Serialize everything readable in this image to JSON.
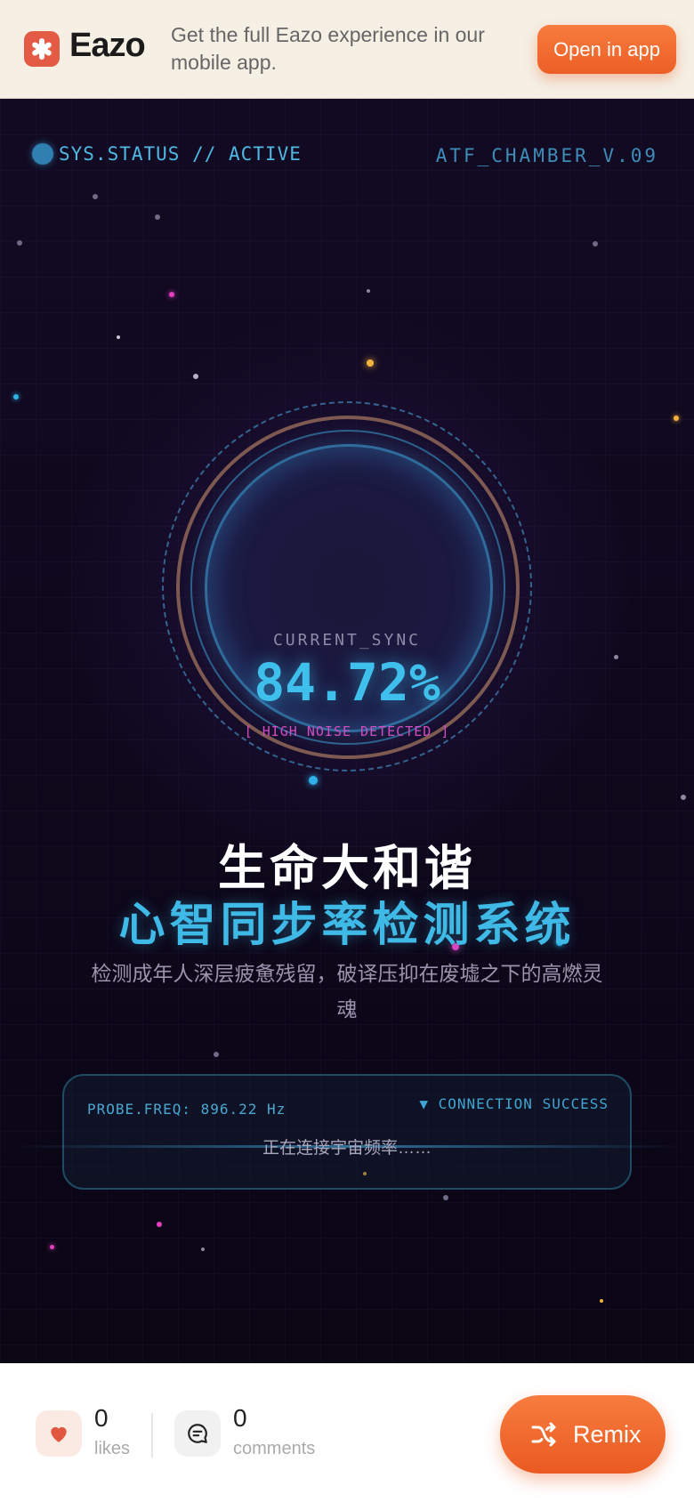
{
  "banner": {
    "logo_text": "Eazo",
    "message": "Get the full Eazo experience in our mobile app.",
    "open_label": "Open in app"
  },
  "hud": {
    "status": "SYS.STATUS // ACTIVE",
    "chamber": "ATF_CHAMBER_V.09"
  },
  "gauge": {
    "label": "CURRENT_SYNC",
    "value": "84.72%",
    "warning": "[ HIGH NOISE DETECTED ]"
  },
  "titles": {
    "line1": "生命大和谐",
    "line2": "心智同步率检测系统",
    "subtitle": "检测成年人深层疲惫残留，破译压抑在废墟之下的高燃灵魂"
  },
  "probe": {
    "frequency": "PROBE.FREQ: 896.22 Hz",
    "connection": "▼ CONNECTION SUCCESS",
    "connecting_text": "正在连接宇宙频率……"
  },
  "footer": {
    "likes_count": "0",
    "likes_label": "likes",
    "comments_count": "0",
    "comments_label": "comments",
    "remix_label": "Remix"
  },
  "icons": {
    "logo": "eazo-logo-icon",
    "heart": "heart-icon",
    "comment": "comment-icon",
    "remix": "shuffle-icon"
  },
  "colors": {
    "accent": "#ec5f26",
    "cyan": "#3fc0ec",
    "magenta": "#d24bc2",
    "background": "#0c0818"
  }
}
